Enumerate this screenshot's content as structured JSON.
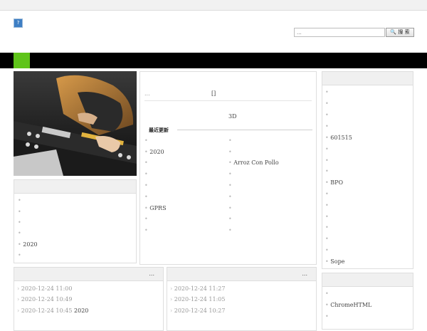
{
  "header": {
    "logo_glyph": "?",
    "search_placeholder": "...",
    "search_button": "🔍 搜 索"
  },
  "colors": {
    "nav_bg": "#000000",
    "nav_accent": "#5fc41a",
    "panel_head": "#f0f0f0"
  },
  "left_box": {
    "title": "",
    "items": [
      "",
      "",
      "",
      "",
      "2020",
      ""
    ]
  },
  "center": {
    "top_text": "...",
    "top_bracket": "[]",
    "sub_text": "3D",
    "recent_title": "最近更新",
    "col1": [
      "",
      "2020",
      "",
      "",
      "",
      "",
      "GPRS",
      "",
      ""
    ],
    "col2": [
      "",
      "",
      "Arroz Con Pollo",
      "",
      "",
      "",
      "",
      "",
      ""
    ]
  },
  "right_box": {
    "title": "",
    "items": [
      "",
      "",
      "",
      "",
      "601515",
      "",
      "",
      "",
      "BPO",
      "",
      "",
      "",
      "",
      "",
      "",
      "Sope"
    ]
  },
  "right_box2": {
    "title": "",
    "items": [
      "",
      "ChromeHTML",
      ""
    ]
  },
  "news1": {
    "title": "",
    "more": "...",
    "rows": [
      {
        "date": "2020-12-24 11:00",
        "text": ""
      },
      {
        "date": "2020-12-24 10:49",
        "text": ""
      },
      {
        "date": "2020-12-24 10:45",
        "text": "2020"
      }
    ]
  },
  "news2": {
    "title": "",
    "more": "...",
    "rows": [
      {
        "date": "2020-12-24 11:27",
        "text": ""
      },
      {
        "date": "2020-12-24 11:05",
        "text": ""
      },
      {
        "date": "2020-12-24 10:27",
        "text": ""
      }
    ]
  }
}
